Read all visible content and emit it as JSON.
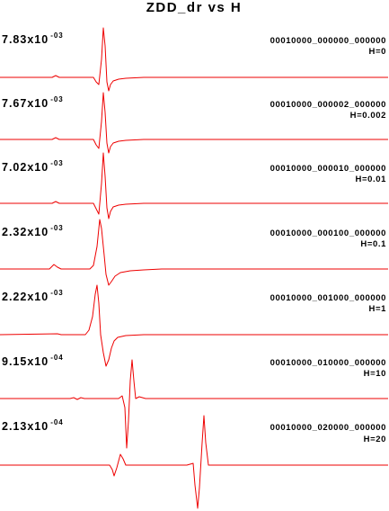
{
  "chart_data": {
    "type": "line",
    "title": "ZDD_dr vs H",
    "line_color": "#ee0000",
    "xlabel": "",
    "ylabel": "",
    "grid": false,
    "series": [
      {
        "amplitude_mantissa": "7.83x10",
        "amplitude_exponent": "-03",
        "id": "00010000_000000_000000",
        "h_label": "H=0"
      },
      {
        "amplitude_mantissa": "7.67x10",
        "amplitude_exponent": "-03",
        "id": "00010000_000002_000000",
        "h_label": "H=0.002"
      },
      {
        "amplitude_mantissa": "7.02x10",
        "amplitude_exponent": "-03",
        "id": "00010000_000010_000000",
        "h_label": "H=0.01"
      },
      {
        "amplitude_mantissa": "2.32x10",
        "amplitude_exponent": "-03",
        "id": "00010000_000100_000000",
        "h_label": "H=0.1"
      },
      {
        "amplitude_mantissa": "2.22x10",
        "amplitude_exponent": "-03",
        "id": "00010000_001000_000000",
        "h_label": "H=1"
      },
      {
        "amplitude_mantissa": "9.15x10",
        "amplitude_exponent": "-04",
        "id": "00010000_010000_000000",
        "h_label": "H=10"
      },
      {
        "amplitude_mantissa": "2.13x10",
        "amplitude_exponent": "-04",
        "id": "00010000_020000_000000",
        "h_label": "H=20"
      }
    ]
  }
}
